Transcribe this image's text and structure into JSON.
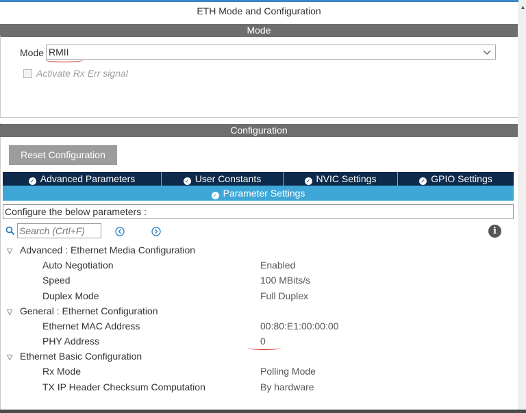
{
  "window": {
    "title": "ETH Mode and Configuration"
  },
  "mode_section": {
    "header": "Mode",
    "mode_label": "Mode",
    "mode_value": "RMII",
    "checkbox_label": "Activate Rx Err signal",
    "checkbox_checked": false
  },
  "config_section": {
    "header": "Configuration",
    "reset_button": "Reset Configuration",
    "tabs": [
      {
        "label": "Advanced Parameters"
      },
      {
        "label": "User Constants"
      },
      {
        "label": "NVIC Settings"
      },
      {
        "label": "GPIO Settings"
      }
    ],
    "active_tab": {
      "label": "Parameter Settings"
    },
    "hint": "Configure the below parameters :",
    "search_placeholder": "Search (Crtl+F)",
    "groups": [
      {
        "title": "Advanced : Ethernet Media Configuration",
        "params": [
          {
            "name": "Auto Negotiation",
            "value": "Enabled"
          },
          {
            "name": "Speed",
            "value": "100 MBits/s"
          },
          {
            "name": "Duplex Mode",
            "value": "Full Duplex"
          }
        ]
      },
      {
        "title": "General : Ethernet Configuration",
        "params": [
          {
            "name": "Ethernet MAC Address",
            "value": "00:80:E1:00:00:00"
          },
          {
            "name": "PHY Address",
            "value": "0"
          }
        ]
      },
      {
        "title": "Ethernet Basic Configuration",
        "params": [
          {
            "name": "Rx Mode",
            "value": "Polling Mode"
          },
          {
            "name": "TX IP Header Checksum Computation",
            "value": "By hardware"
          }
        ]
      }
    ]
  },
  "colors": {
    "section_bar": "#6e6e6e",
    "tab_dark": "#0d2a4a",
    "tab_active": "#3ea7d8",
    "annotation_red": "#d0201a"
  }
}
